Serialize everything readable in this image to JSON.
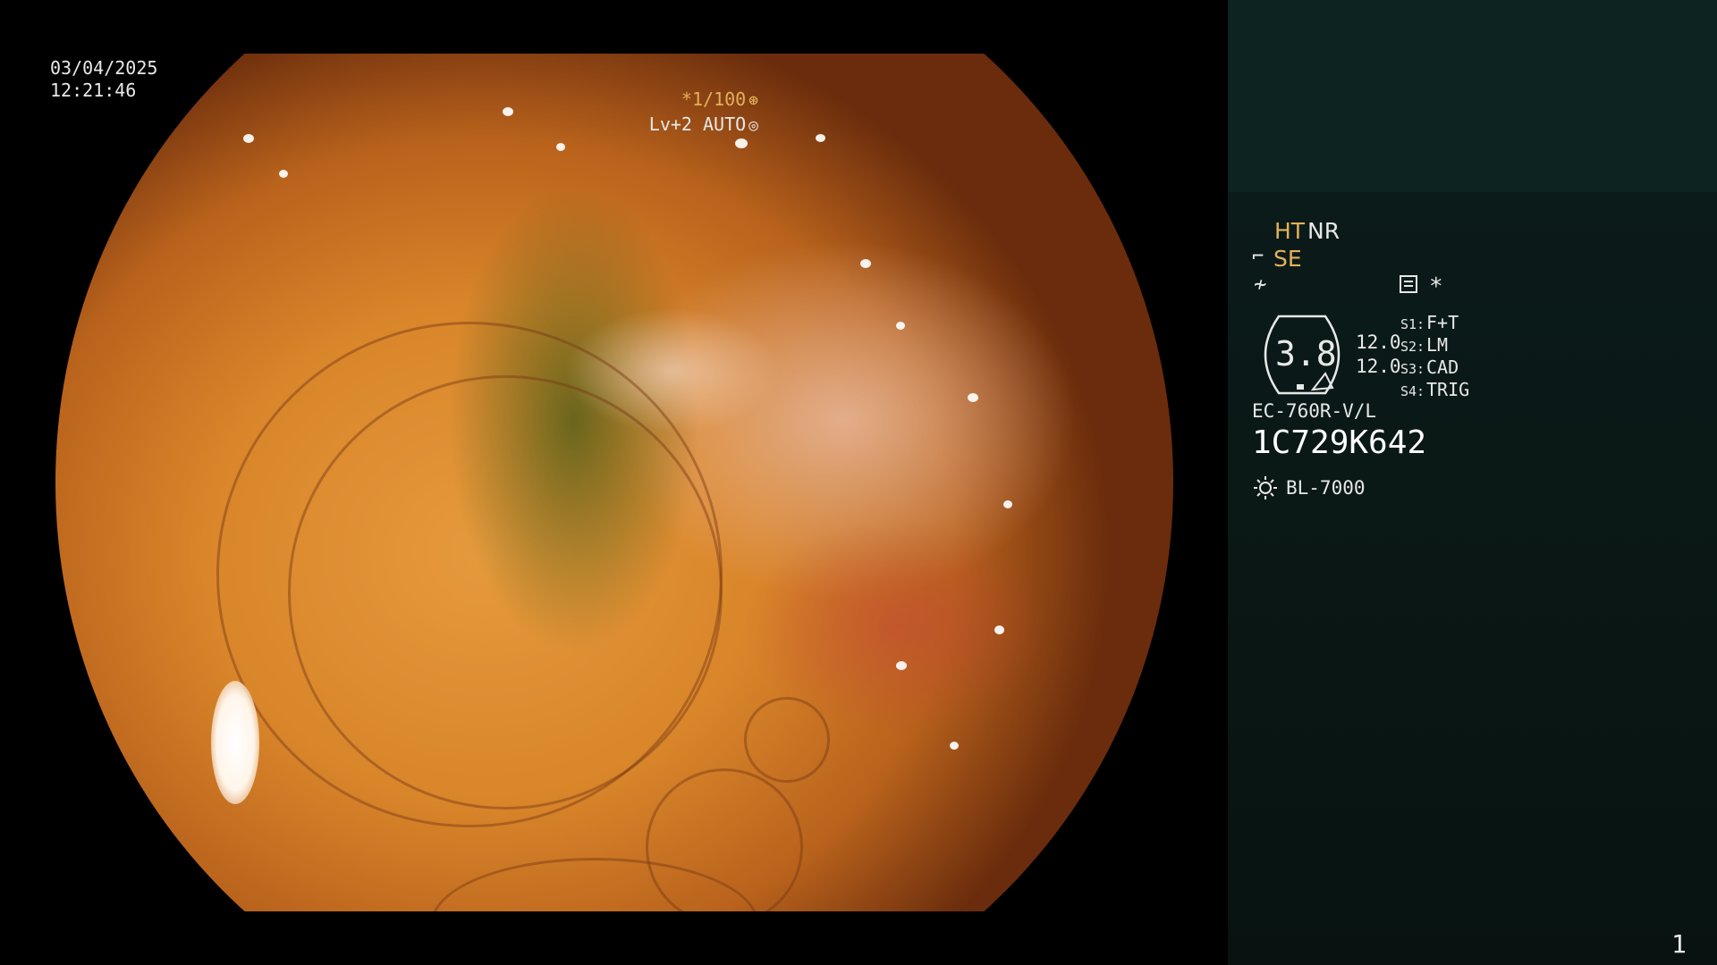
{
  "overlay": {
    "date": "03/04/2025",
    "time": "12:21:46",
    "shutter": "*1/100",
    "shutter_icon": "aperture-icon",
    "level": "Lv+2 AUTO",
    "level_icon": "iris-icon"
  },
  "panel": {
    "ht": "HT",
    "nr": "NR",
    "se": "SE",
    "se_icon": "structure-enhance-icon",
    "f_icon": "freeze-icon",
    "memo_icon": "document-icon",
    "asterisk": "*",
    "gauge_value": "3.8",
    "values": [
      "12.0",
      "12.0"
    ],
    "switches": [
      {
        "key": "S1:",
        "value": "F+T"
      },
      {
        "key": "S2:",
        "value": "LM"
      },
      {
        "key": "S3:",
        "value": "CAD"
      },
      {
        "key": "S4:",
        "value": "TRIG"
      }
    ],
    "scope_model": "EC-760R-V/L",
    "serial": "1C729K642",
    "light_icon": "sun-icon",
    "light_source": "BL-7000",
    "page_number": "1"
  },
  "colors": {
    "accent_orange": "#e3b15a",
    "panel_top": "#0d2321",
    "panel_bg": "#0b1b19",
    "text": "#e8e8e8"
  }
}
